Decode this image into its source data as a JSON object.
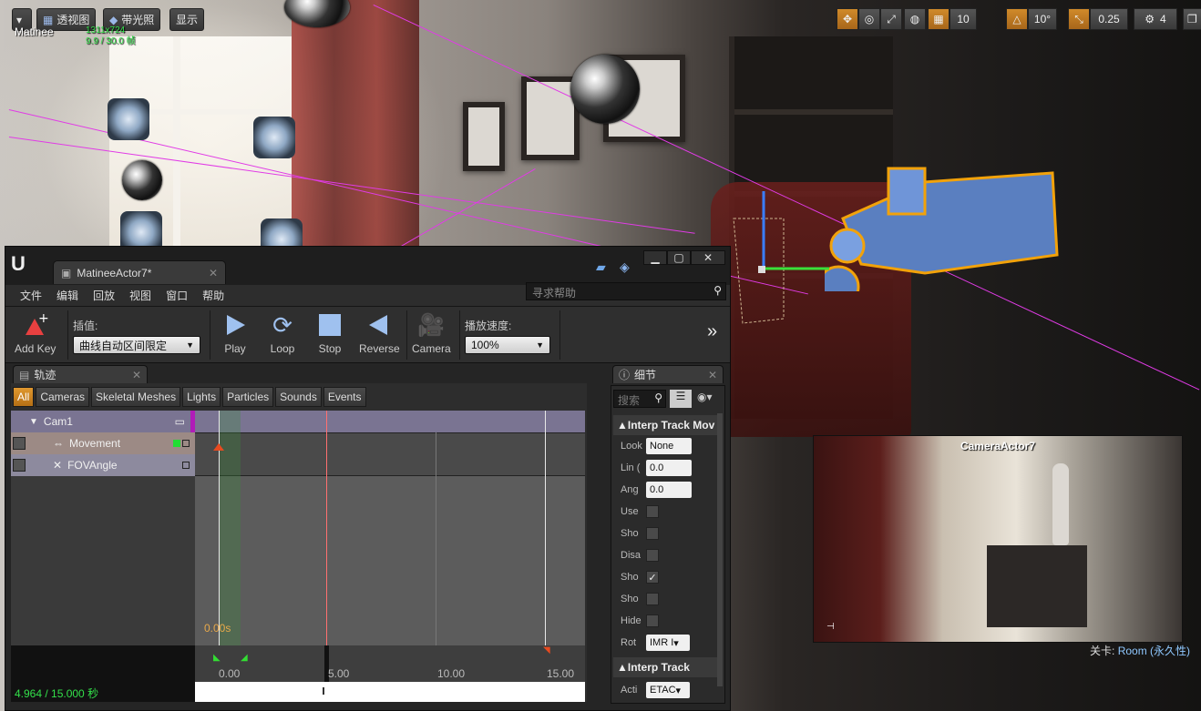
{
  "viewport": {
    "buttons": {
      "menu": "▾",
      "perspective": "透视图",
      "lit": "带光照",
      "show": "显示"
    },
    "label": "Matinee",
    "stats_resolution": "1311x724",
    "stats_fps": "9.9 / 30.0 帧",
    "toolbar_right": {
      "grid_snap": "10",
      "rot_snap": "10°",
      "scale_snap": "0.25",
      "cam_speed": "4"
    },
    "level_prefix": "关卡:",
    "level_value": "Room (永久性)"
  },
  "preview": {
    "title": "CameraActor7"
  },
  "matinee": {
    "doc_tab": "MatineeActor7*",
    "menu": [
      "文件",
      "编辑",
      "回放",
      "视图",
      "窗口",
      "帮助"
    ],
    "help_placeholder": "寻求帮助",
    "toolbar": {
      "add_key": "Add Key",
      "interp_label": "插值:",
      "interp_value": "曲线自动区间限定",
      "play": "Play",
      "loop": "Loop",
      "stop": "Stop",
      "reverse": "Reverse",
      "camera": "Camera",
      "speed_label": "播放速度:",
      "speed_value": "100%"
    },
    "tracks_tab": "轨迹",
    "filters": [
      "All",
      "Cameras",
      "Skeletal Meshes",
      "Lights",
      "Particles",
      "Sounds",
      "Events"
    ],
    "group": "Cam1",
    "tracks": [
      "Movement",
      "FOVAngle"
    ],
    "key_time": "0.00s",
    "ticks": [
      "0.00",
      "5.00",
      "10.00",
      "15.00"
    ],
    "time_status": "4.964 / 15.000 秒",
    "details_tab": "细节",
    "details_search": "搜索",
    "details_section1": "Interp Track Mov",
    "details_rows": [
      {
        "label": "Look",
        "value": "None"
      },
      {
        "label": "Lin (",
        "value": "0.0"
      },
      {
        "label": "Ang",
        "value": "0.0"
      },
      {
        "label": "Use",
        "checked": false
      },
      {
        "label": "Sho",
        "checked": false
      },
      {
        "label": "Disa",
        "checked": false
      },
      {
        "label": "Sho",
        "checked": true
      },
      {
        "label": "Sho",
        "checked": false
      },
      {
        "label": "Hide",
        "checked": false
      },
      {
        "label": "Rot",
        "value": "IMR I"
      }
    ],
    "details_section2": "Interp Track",
    "details_last": {
      "label": "Acti",
      "value": "ETAC"
    }
  },
  "colors": {
    "accent": "#e0982f",
    "group_bg": "#7a7492",
    "track_bg": "#9c8a85",
    "magenta": "#e13be6"
  }
}
